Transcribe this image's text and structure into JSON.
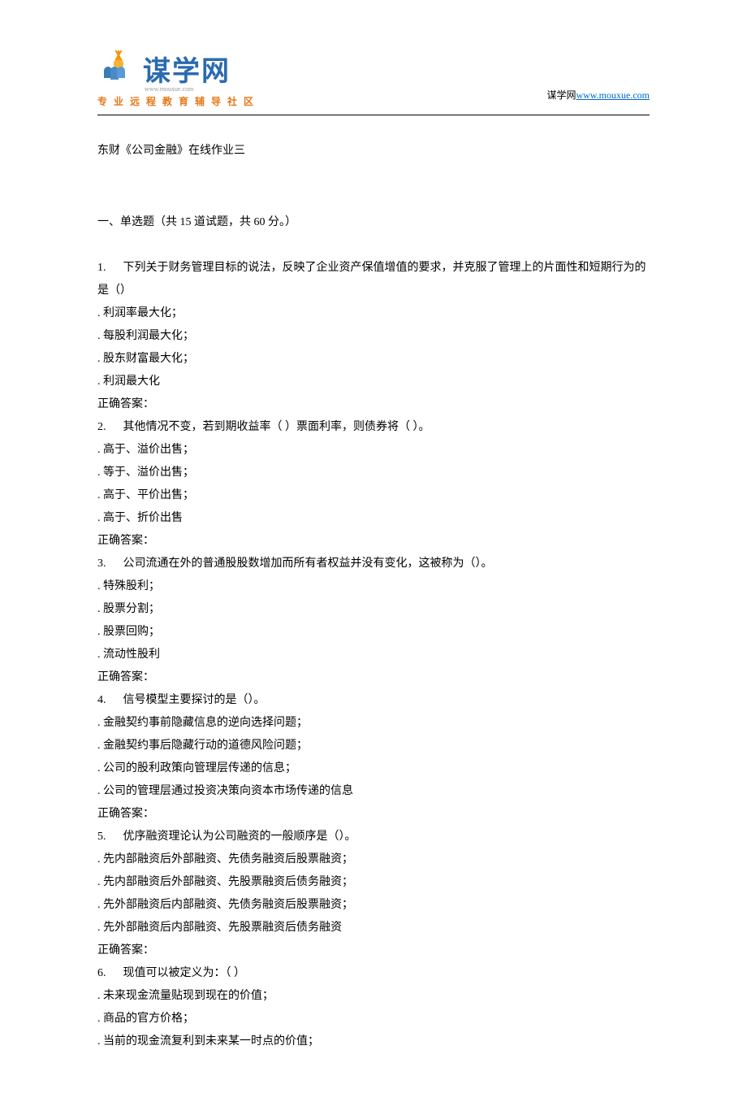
{
  "header": {
    "logo_text": "谋学网",
    "logo_url_small": "www.mouxue.com",
    "tagline": "专业远程教育辅导社区",
    "right_prefix": "谋学网",
    "right_link": "www.mouxue.com"
  },
  "document": {
    "title": "东财《公司金融》在线作业三",
    "section_label": "一、单选题（共 15 道试题，共 60 分。）",
    "questions": [
      {
        "num": "1.",
        "stem": "下列关于财务管理目标的说法，反映了企业资产保值增值的要求，并克服了管理上的片面性和短期行为的是（）",
        "options": [
          ". 利润率最大化；",
          ". 每股利润最大化；",
          ". 股东财富最大化；",
          ". 利润最大化"
        ],
        "answer_label": "正确答案："
      },
      {
        "num": "2.",
        "stem": "其他情况不变，若到期收益率（ ）票面利率，则债券将（ ）。",
        "options": [
          ". 高于、溢价出售；",
          ". 等于、溢价出售；",
          ". 高于、平价出售；",
          ". 高于、折价出售"
        ],
        "answer_label": "正确答案："
      },
      {
        "num": "3.",
        "stem": "公司流通在外的普通股股数增加而所有者权益并没有变化，这被称为（）。",
        "options": [
          ". 特殊股利；",
          ". 股票分割；",
          ". 股票回购；",
          ". 流动性股利"
        ],
        "answer_label": "正确答案："
      },
      {
        "num": "4.",
        "stem": "信号模型主要探讨的是（）。",
        "options": [
          ". 金融契约事前隐藏信息的逆向选择问题；",
          ". 金融契约事后隐藏行动的道德风险问题；",
          ". 公司的股利政策向管理层传递的信息；",
          ". 公司的管理层通过投资决策向资本市场传递的信息"
        ],
        "answer_label": "正确答案："
      },
      {
        "num": "5.",
        "stem": "优序融资理论认为公司融资的一般顺序是（）。",
        "options": [
          ". 先内部融资后外部融资、先债务融资后股票融资；",
          ". 先内部融资后外部融资、先股票融资后债务融资；",
          ". 先外部融资后内部融资、先债务融资后股票融资；",
          ". 先外部融资后内部融资、先股票融资后债务融资"
        ],
        "answer_label": "正确答案："
      },
      {
        "num": "6.",
        "stem": "现值可以被定义为：（ ）",
        "options": [
          ". 未来现金流量贴现到现在的价值；",
          ". 商品的官方价格；",
          ". 当前的现金流复利到未来某一时点的价值；"
        ],
        "answer_label": ""
      }
    ]
  }
}
